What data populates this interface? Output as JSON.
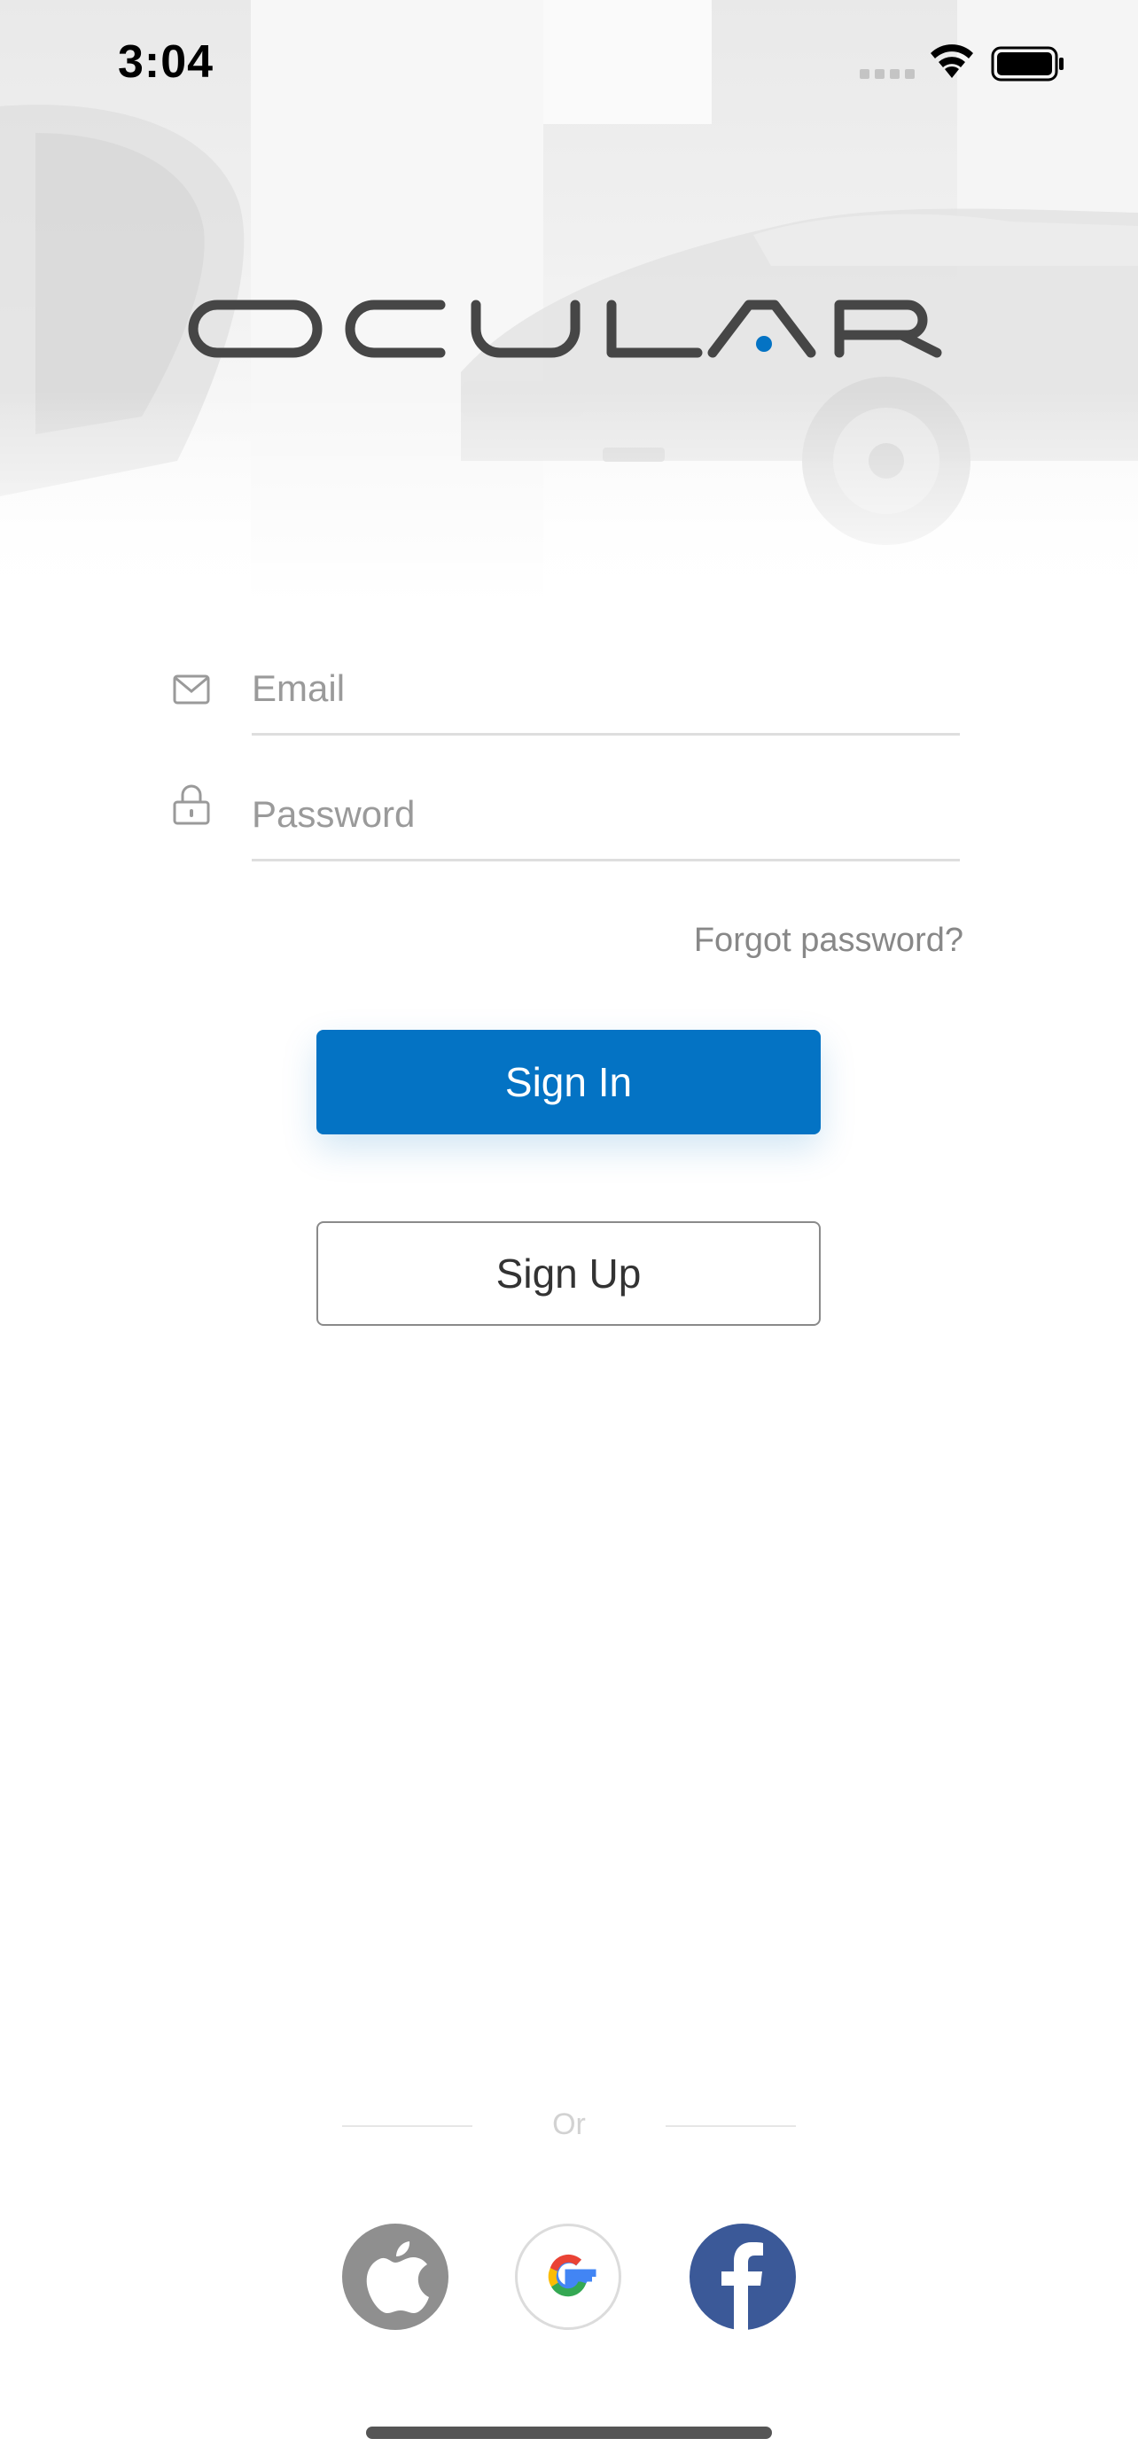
{
  "status_bar": {
    "time": "3:04"
  },
  "brand": {
    "logo_text": "OCULAR",
    "accent_color": "#0473c4"
  },
  "login_form": {
    "email": {
      "placeholder": "Email",
      "value": ""
    },
    "password": {
      "placeholder": "Password",
      "value": ""
    },
    "forgot_password_label": "Forgot password?",
    "sign_in_label": "Sign In",
    "sign_up_label": "Sign Up"
  },
  "social": {
    "divider_label": "Or",
    "providers": [
      {
        "name": "apple-icon",
        "color": "#8f8f8f"
      },
      {
        "name": "google-icon",
        "color": "#ffffff"
      },
      {
        "name": "facebook-icon",
        "color": "#3b5998"
      }
    ]
  }
}
